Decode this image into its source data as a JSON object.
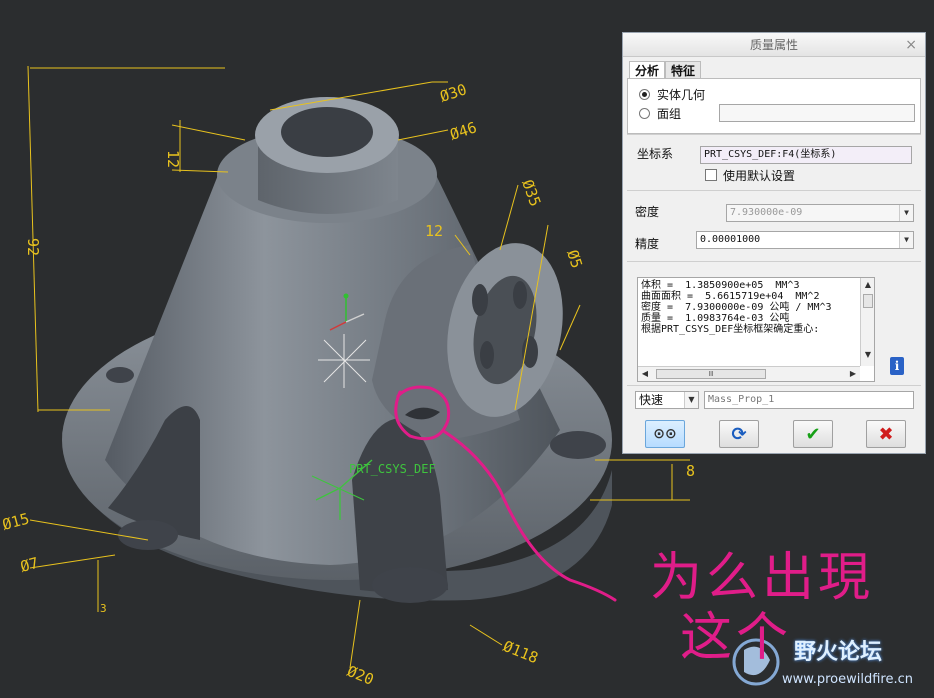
{
  "dimensions": {
    "d30": "Ø30",
    "d46": "Ø46",
    "d35": "Ø35",
    "d5": "Ø5",
    "d15": "Ø15",
    "d7": "Ø7",
    "d118": "Ø118",
    "d20": "Ø20",
    "n12a": "12",
    "n12b": "12",
    "n92": "92",
    "n8": "8",
    "n3": "3"
  },
  "csys_label": "PRT_CSYS_DEF",
  "dialog": {
    "title": "质量属性",
    "close": "×",
    "tabs": [
      "分析",
      "特征"
    ],
    "radio_solid": "实体几何",
    "radio_quilt": "面组",
    "csys_label": "坐标系",
    "csys_value": "PRT_CSYS_DEF:F4(坐标系)",
    "use_default": "使用默认设置",
    "density_label": "密度",
    "density_value": "7.930000e-09",
    "accuracy_label": "精度",
    "accuracy_value": "0.00001000",
    "results": [
      "体积 =  1.3850900e+05  MM^3",
      "曲面面积 =  5.6615719e+04  MM^2",
      "密度 =  7.9300000e-09 公吨 / MM^3",
      "质量 =  1.0983764e-03 公吨",
      "",
      "根据PRT_CSYS_DEF坐标框架确定重心:"
    ],
    "hscroll_thumb": "Ⅲ",
    "mode_value": "快速",
    "name_value": "Mass_Prop_1"
  },
  "annotation": {
    "line1": "为么出現",
    "line2": "这个"
  },
  "watermark": {
    "title": "野火论坛",
    "url": "www.proewildfire.cn"
  },
  "colors": {
    "background": "#2b2d2f",
    "dimension": "#e8c21e",
    "annotation": "#e01d89",
    "csys": "#3ec43e"
  }
}
